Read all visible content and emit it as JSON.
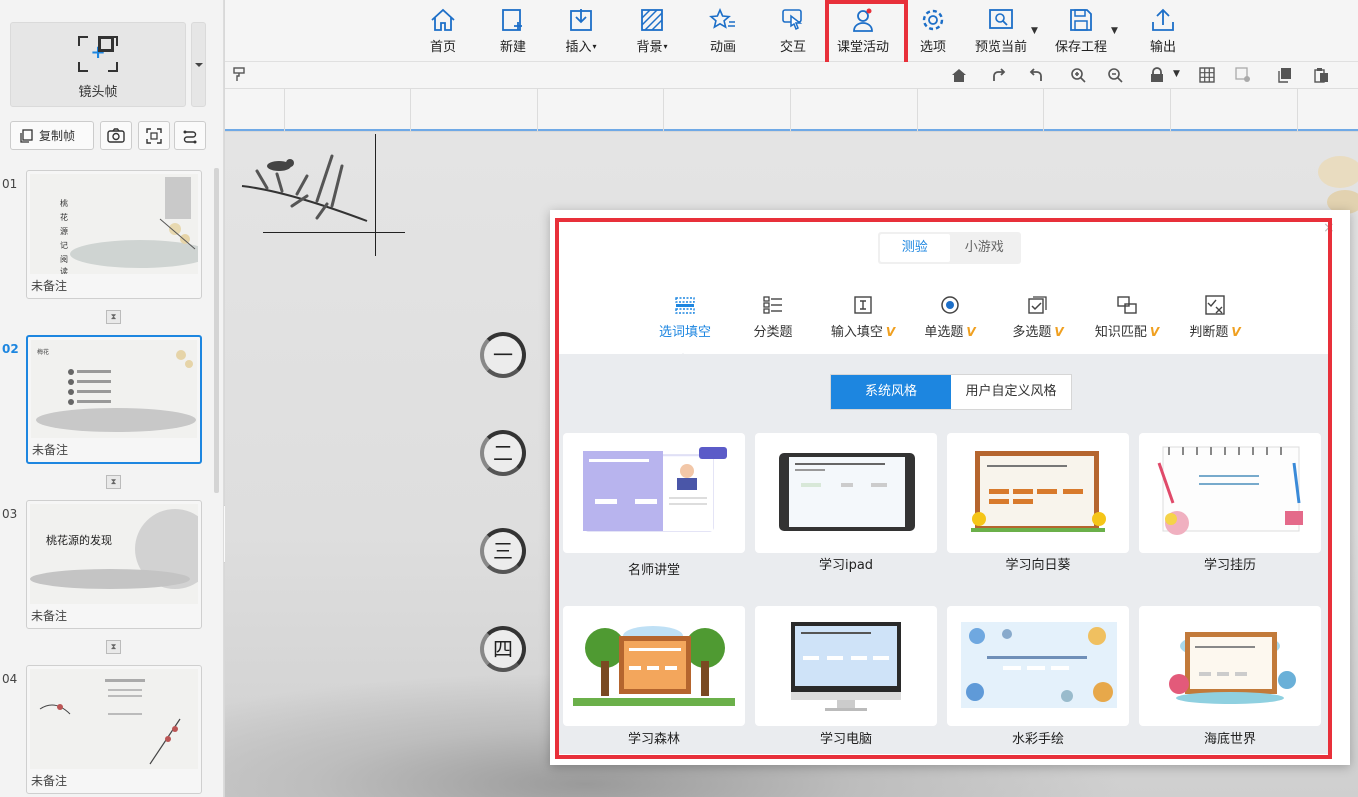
{
  "left_panel": {
    "frame_button_label": "镜头帧",
    "copy_frame_label": "复制帧",
    "slides": [
      {
        "num": "01",
        "note": "未备注",
        "title": "桃花源记阅读"
      },
      {
        "num": "02",
        "note": "未备注"
      },
      {
        "num": "03",
        "note": "未备注",
        "title": "桃花源的发现"
      },
      {
        "num": "04",
        "note": "未备注"
      }
    ]
  },
  "toolbar": {
    "items": [
      {
        "label": "首页",
        "icon": "home-icon"
      },
      {
        "label": "新建",
        "icon": "new-icon"
      },
      {
        "label": "插入",
        "icon": "insert-icon"
      },
      {
        "label": "背景",
        "icon": "background-icon"
      },
      {
        "label": "动画",
        "icon": "animation-icon"
      },
      {
        "label": "交互",
        "icon": "interaction-icon"
      },
      {
        "label": "课堂活动",
        "icon": "classroom-activity-icon"
      },
      {
        "label": "选项",
        "icon": "settings-icon"
      },
      {
        "label": "预览当前",
        "icon": "preview-icon"
      },
      {
        "label": "保存工程",
        "icon": "save-icon"
      },
      {
        "label": "输出",
        "icon": "export-icon"
      }
    ],
    "highlight_color": "#e8303a"
  },
  "canvas": {
    "circles": [
      "一",
      "二",
      "三",
      "四"
    ]
  },
  "dialog": {
    "tabs": [
      {
        "label": "测验"
      },
      {
        "label": "小游戏"
      }
    ],
    "question_types": [
      {
        "label": "选词填空",
        "vip": false
      },
      {
        "label": "分类题",
        "vip": false
      },
      {
        "label": "输入填空",
        "vip": true
      },
      {
        "label": "单选题",
        "vip": true
      },
      {
        "label": "多选题",
        "vip": true
      },
      {
        "label": "知识匹配",
        "vip": true
      },
      {
        "label": "判断题",
        "vip": true
      }
    ],
    "vip_mark": "V",
    "style_tabs": [
      {
        "label": "系统风格"
      },
      {
        "label": "用户自定义风格"
      }
    ],
    "templates": [
      {
        "label": "名师讲堂"
      },
      {
        "label": "学习ipad"
      },
      {
        "label": "学习向日葵"
      },
      {
        "label": "学习挂历"
      },
      {
        "label": "学习森林"
      },
      {
        "label": "学习电脑"
      },
      {
        "label": "水彩手绘"
      },
      {
        "label": "海底世界"
      }
    ],
    "accent_color": "#1d86e0"
  }
}
